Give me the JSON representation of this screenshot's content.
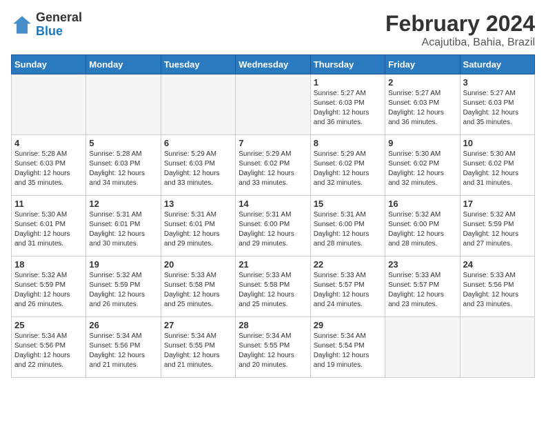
{
  "header": {
    "logo_general": "General",
    "logo_blue": "Blue",
    "month_title": "February 2024",
    "location": "Acajutiba, Bahia, Brazil"
  },
  "weekdays": [
    "Sunday",
    "Monday",
    "Tuesday",
    "Wednesday",
    "Thursday",
    "Friday",
    "Saturday"
  ],
  "weeks": [
    [
      {
        "day": "",
        "info": ""
      },
      {
        "day": "",
        "info": ""
      },
      {
        "day": "",
        "info": ""
      },
      {
        "day": "",
        "info": ""
      },
      {
        "day": "1",
        "info": "Sunrise: 5:27 AM\nSunset: 6:03 PM\nDaylight: 12 hours\nand 36 minutes."
      },
      {
        "day": "2",
        "info": "Sunrise: 5:27 AM\nSunset: 6:03 PM\nDaylight: 12 hours\nand 36 minutes."
      },
      {
        "day": "3",
        "info": "Sunrise: 5:27 AM\nSunset: 6:03 PM\nDaylight: 12 hours\nand 35 minutes."
      }
    ],
    [
      {
        "day": "4",
        "info": "Sunrise: 5:28 AM\nSunset: 6:03 PM\nDaylight: 12 hours\nand 35 minutes."
      },
      {
        "day": "5",
        "info": "Sunrise: 5:28 AM\nSunset: 6:03 PM\nDaylight: 12 hours\nand 34 minutes."
      },
      {
        "day": "6",
        "info": "Sunrise: 5:29 AM\nSunset: 6:03 PM\nDaylight: 12 hours\nand 33 minutes."
      },
      {
        "day": "7",
        "info": "Sunrise: 5:29 AM\nSunset: 6:02 PM\nDaylight: 12 hours\nand 33 minutes."
      },
      {
        "day": "8",
        "info": "Sunrise: 5:29 AM\nSunset: 6:02 PM\nDaylight: 12 hours\nand 32 minutes."
      },
      {
        "day": "9",
        "info": "Sunrise: 5:30 AM\nSunset: 6:02 PM\nDaylight: 12 hours\nand 32 minutes."
      },
      {
        "day": "10",
        "info": "Sunrise: 5:30 AM\nSunset: 6:02 PM\nDaylight: 12 hours\nand 31 minutes."
      }
    ],
    [
      {
        "day": "11",
        "info": "Sunrise: 5:30 AM\nSunset: 6:01 PM\nDaylight: 12 hours\nand 31 minutes."
      },
      {
        "day": "12",
        "info": "Sunrise: 5:31 AM\nSunset: 6:01 PM\nDaylight: 12 hours\nand 30 minutes."
      },
      {
        "day": "13",
        "info": "Sunrise: 5:31 AM\nSunset: 6:01 PM\nDaylight: 12 hours\nand 29 minutes."
      },
      {
        "day": "14",
        "info": "Sunrise: 5:31 AM\nSunset: 6:00 PM\nDaylight: 12 hours\nand 29 minutes."
      },
      {
        "day": "15",
        "info": "Sunrise: 5:31 AM\nSunset: 6:00 PM\nDaylight: 12 hours\nand 28 minutes."
      },
      {
        "day": "16",
        "info": "Sunrise: 5:32 AM\nSunset: 6:00 PM\nDaylight: 12 hours\nand 28 minutes."
      },
      {
        "day": "17",
        "info": "Sunrise: 5:32 AM\nSunset: 5:59 PM\nDaylight: 12 hours\nand 27 minutes."
      }
    ],
    [
      {
        "day": "18",
        "info": "Sunrise: 5:32 AM\nSunset: 5:59 PM\nDaylight: 12 hours\nand 26 minutes."
      },
      {
        "day": "19",
        "info": "Sunrise: 5:32 AM\nSunset: 5:59 PM\nDaylight: 12 hours\nand 26 minutes."
      },
      {
        "day": "20",
        "info": "Sunrise: 5:33 AM\nSunset: 5:58 PM\nDaylight: 12 hours\nand 25 minutes."
      },
      {
        "day": "21",
        "info": "Sunrise: 5:33 AM\nSunset: 5:58 PM\nDaylight: 12 hours\nand 25 minutes."
      },
      {
        "day": "22",
        "info": "Sunrise: 5:33 AM\nSunset: 5:57 PM\nDaylight: 12 hours\nand 24 minutes."
      },
      {
        "day": "23",
        "info": "Sunrise: 5:33 AM\nSunset: 5:57 PM\nDaylight: 12 hours\nand 23 minutes."
      },
      {
        "day": "24",
        "info": "Sunrise: 5:33 AM\nSunset: 5:56 PM\nDaylight: 12 hours\nand 23 minutes."
      }
    ],
    [
      {
        "day": "25",
        "info": "Sunrise: 5:34 AM\nSunset: 5:56 PM\nDaylight: 12 hours\nand 22 minutes."
      },
      {
        "day": "26",
        "info": "Sunrise: 5:34 AM\nSunset: 5:56 PM\nDaylight: 12 hours\nand 21 minutes."
      },
      {
        "day": "27",
        "info": "Sunrise: 5:34 AM\nSunset: 5:55 PM\nDaylight: 12 hours\nand 21 minutes."
      },
      {
        "day": "28",
        "info": "Sunrise: 5:34 AM\nSunset: 5:55 PM\nDaylight: 12 hours\nand 20 minutes."
      },
      {
        "day": "29",
        "info": "Sunrise: 5:34 AM\nSunset: 5:54 PM\nDaylight: 12 hours\nand 19 minutes."
      },
      {
        "day": "",
        "info": ""
      },
      {
        "day": "",
        "info": ""
      }
    ]
  ]
}
